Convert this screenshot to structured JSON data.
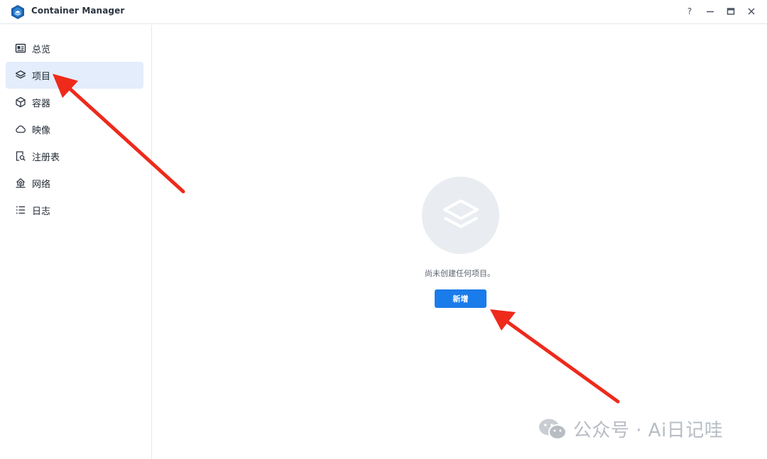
{
  "window": {
    "title": "Container Manager",
    "controls": [
      "help-icon",
      "minimize-icon",
      "maximize-icon",
      "close-icon"
    ],
    "help_label": "?"
  },
  "sidebar": {
    "items": [
      {
        "label": "总览",
        "icon": "overview-icon",
        "active": false
      },
      {
        "label": "项目",
        "icon": "layers-icon",
        "active": true
      },
      {
        "label": "容器",
        "icon": "cube-icon",
        "active": false
      },
      {
        "label": "映像",
        "icon": "cloud-icon",
        "active": false
      },
      {
        "label": "注册表",
        "icon": "registry-search-icon",
        "active": false
      },
      {
        "label": "网络",
        "icon": "network-icon",
        "active": false
      },
      {
        "label": "日志",
        "icon": "list-icon",
        "active": false
      }
    ]
  },
  "main": {
    "empty_icon": "layers-icon",
    "empty_message": "尚未创建任何项目。",
    "add_button_label": "新增"
  },
  "watermark": {
    "text": "公众号 · Ai日记哇",
    "icon": "wechat-icon"
  },
  "colors": {
    "accent": "#1a7bea",
    "active_bg": "#e3edfb",
    "arrow": "#ee2a1b"
  }
}
